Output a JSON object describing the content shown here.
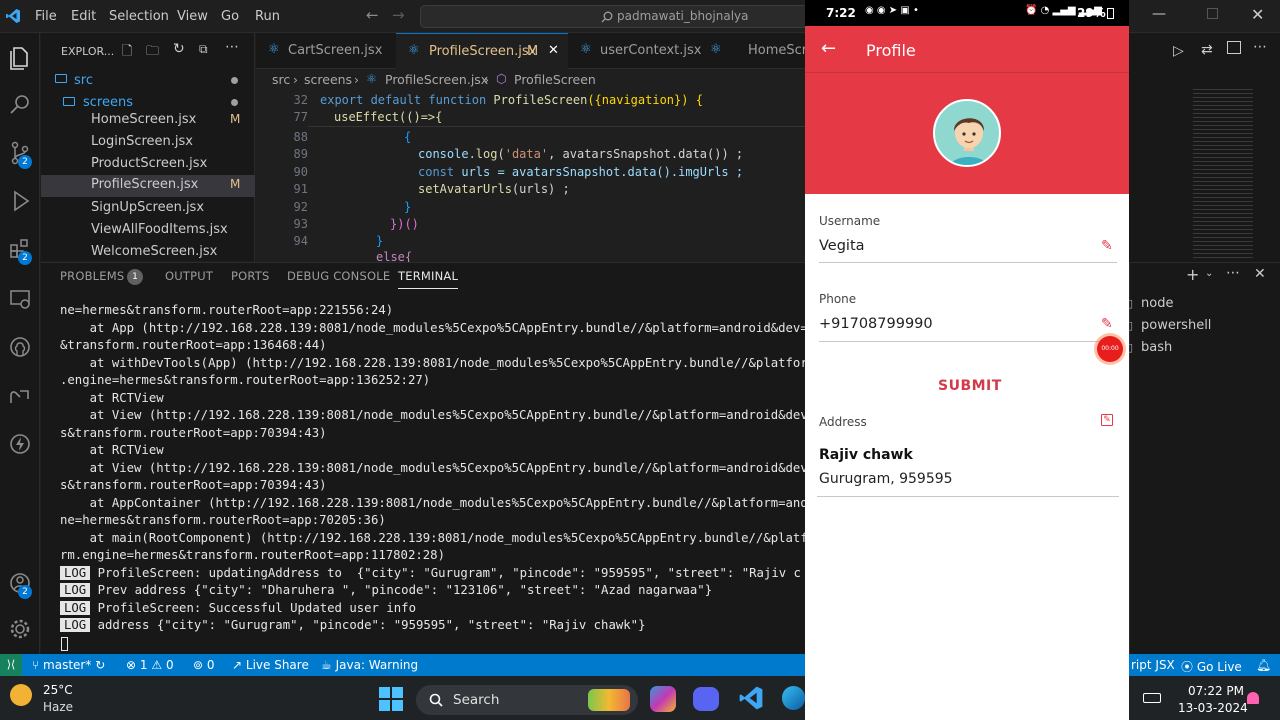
{
  "titlebar": {
    "menus": [
      "File",
      "Edit",
      "Selection",
      "View",
      "Go",
      "Run"
    ],
    "search": "padmawati_bhojnalya"
  },
  "explorer": {
    "header": "EXPLOR...",
    "root": "src",
    "folder": "screens",
    "files": [
      {
        "name": "HomeScreen.jsx",
        "mod": "M"
      },
      {
        "name": "LoginScreen.jsx",
        "mod": ""
      },
      {
        "name": "ProductScreen.jsx",
        "mod": ""
      },
      {
        "name": "ProfileScreen.jsx",
        "mod": "M"
      },
      {
        "name": "SignUpScreen.jsx",
        "mod": ""
      },
      {
        "name": "ViewAllFoodItems.jsx",
        "mod": ""
      },
      {
        "name": "WelcomeScreen.jsx",
        "mod": ""
      }
    ]
  },
  "activity_badges": {
    "source_control": "2",
    "extensions": "2",
    "accounts": "2"
  },
  "tabs": [
    {
      "label": "CartScreen.jsx"
    },
    {
      "label": "ProfileScreen.jsx",
      "suffix": "M"
    },
    {
      "label": "userContext.jsx"
    },
    {
      "label": "HomeScre"
    }
  ],
  "breadcrumb": {
    "p1": "src",
    "p2": "screens",
    "p3": "ProfileScreen.jsx",
    "p4": "ProfileScreen"
  },
  "code": {
    "line_numbers": [
      "32",
      "77",
      "88",
      "89",
      "90",
      "91",
      "92",
      "93",
      "94"
    ],
    "l32_kw": "export default function",
    "l32_fn": "ProfileScreen",
    "l32_rest": "({navigation}) {",
    "l77": "useEffect(()=>{",
    "l88": "{",
    "l89_a": "console.",
    "l89_fn": "log",
    "l89_str": "'data'",
    "l89_b": ", avatarsSnapshot.data()) ;",
    "l90_kw": "const",
    "l90_b": " urls = avatarsSnapshot.data().imgUrls ;",
    "l91_fn": "setAvatarUrls",
    "l91_b": "(urls) ;",
    "l92": "}",
    "l93": "})()",
    "l94": "}",
    "l95": "else{"
  },
  "panel": {
    "tabs": [
      "PROBLEMS",
      "OUTPUT",
      "PORTS",
      "DEBUG CONSOLE",
      "TERMINAL"
    ],
    "problems_count": "1",
    "terminal_lines": [
      "ne=hermes&transform.routerRoot=app:221556:24)",
      "    at App (http://192.168.228.139:8081/node_modules%5Cexpo%5CAppEntry.bundle//&platform=android&dev=",
      "&transform.routerRoot=app:136468:44)",
      "    at withDevTools(App) (http://192.168.228.139:8081/node_modules%5Cexpo%5CAppEntry.bundle//&platfor",
      ".engine=hermes&transform.routerRoot=app:136252:27)",
      "    at RCTView",
      "    at View (http://192.168.228.139:8081/node_modules%5Cexpo%5CAppEntry.bundle//&platform=android&dev",
      "s&transform.routerRoot=app:70394:43)",
      "    at RCTView",
      "    at View (http://192.168.228.139:8081/node_modules%5Cexpo%5CAppEntry.bundle//&platform=android&dev",
      "s&transform.routerRoot=app:70394:43)",
      "    at AppContainer (http://192.168.228.139:8081/node_modules%5Cexpo%5CAppEntry.bundle//&platform=and",
      "ne=hermes&transform.routerRoot=app:70205:36)",
      "    at main(RootComponent) (http://192.168.228.139:8081/node_modules%5Cexpo%5CAppEntry.bundle//&platf",
      "rm.engine=hermes&transform.routerRoot=app:117802:28)"
    ],
    "log_tag": "LOG",
    "log_lines": [
      "ProfileScreen: updatingAddress to  {\"city\": \"Gurugram\", \"pincode\": \"959595\", \"street\": \"Rajiv c",
      "Prev address {\"city\": \"Dharuhera \", \"pincode\": \"123106\", \"street\": \"Azad nagarwaa\"}",
      "ProfileScreen: Successful Updated user info",
      "address {\"city\": \"Gurugram\", \"pincode\": \"959595\", \"street\": \"Rajiv chawk\"}"
    ]
  },
  "shells": [
    "node",
    "powershell",
    "bash"
  ],
  "statusbar": {
    "branch": "master*",
    "errors": "1",
    "warnings": "0",
    "ports": "0",
    "live_share": "Live Share",
    "java": "Java: Warning",
    "lang": "ript JSX",
    "go_live": "Go Live"
  },
  "taskbar": {
    "temp": "25°C",
    "weather": "Haze",
    "search": "Search",
    "time": "07:22 PM",
    "date": "13-03-2024"
  },
  "phone": {
    "time": "7:22",
    "battery": "29%",
    "title": "Profile",
    "username_label": "Username",
    "username": "Vegita",
    "phone_label": "Phone",
    "phone": "+91708799990",
    "submit": "SUBMIT",
    "address_label": "Address",
    "street": "Rajiv chawk",
    "city_line": "Gurugram, 959595",
    "rec_timer": "00:00"
  },
  "colors": {
    "accent": "#007acc",
    "profile_red": "#e63946"
  }
}
